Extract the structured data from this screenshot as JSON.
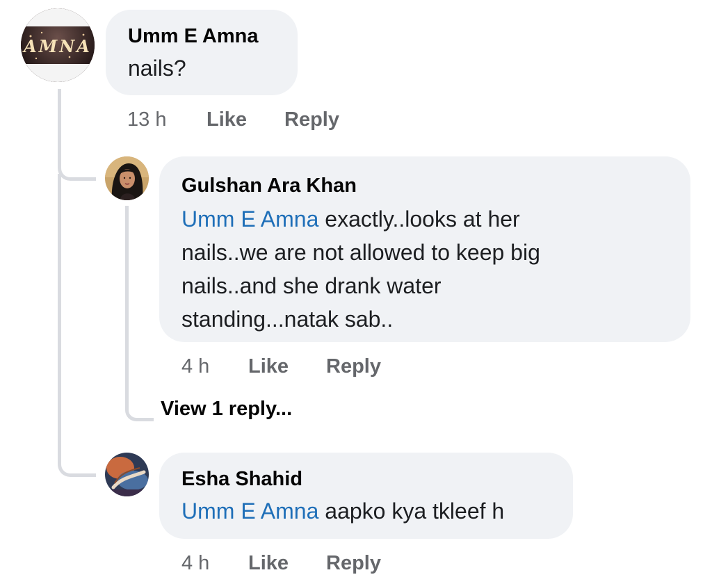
{
  "comments": [
    {
      "author": "Umm E Amna",
      "avatar_text": "AMNA",
      "avatar_icon": "amna-text-avatar",
      "text": "nails?",
      "time": "13 h",
      "like": "Like",
      "reply": "Reply"
    },
    {
      "author": "Gulshan Ara Khan",
      "avatar_icon": "woman-portrait-avatar",
      "mention": "Umm E Amna",
      "text_line1": " exactly..looks at her",
      "text_line2": "nails..we are not allowed to keep big",
      "text_line3": "nails..and she drank water",
      "text_line4": "standing...natak sab..",
      "time": "4 h",
      "like": "Like",
      "reply": "Reply",
      "view_replies": "View 1 reply..."
    },
    {
      "author": "Esha Shahid",
      "avatar_icon": "hands-henna-avatar",
      "mention": "Umm E Amna",
      "text": " aapko kya tkleef h",
      "time": "4 h",
      "like": "Like",
      "reply": "Reply"
    }
  ],
  "colors": {
    "bubble_bg": "#f0f2f5",
    "mention": "#1f6fb8",
    "meta": "#65676b",
    "thread_line": "#d9dbe0"
  }
}
